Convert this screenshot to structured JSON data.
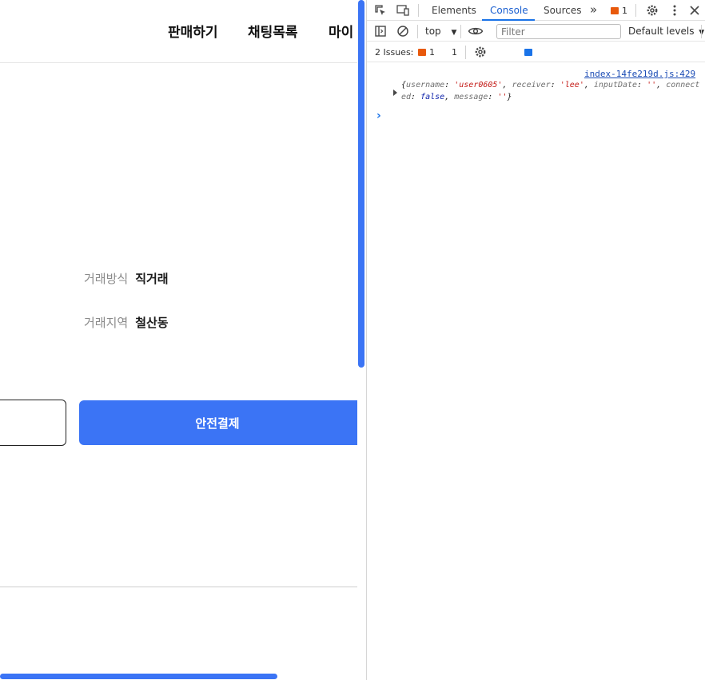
{
  "nav": {
    "sell": "판매하기",
    "chat": "채팅목록",
    "my": "마이"
  },
  "trade": {
    "method_label": "거래방식",
    "method_value": "직거래",
    "region_label": "거래지역",
    "region_value": "철산동"
  },
  "buttons": {
    "pay": "안전결제"
  },
  "devtools": {
    "tabs": {
      "elements": "Elements",
      "console": "Console",
      "sources": "Sources",
      "more": "»",
      "warn_count": "1"
    },
    "toolbar": {
      "context": "top",
      "filter_placeholder": "Filter",
      "levels": "Default levels"
    },
    "issues": {
      "label": "2 Issues:",
      "warn": "1",
      "info": "1"
    },
    "console": {
      "source": "index-14fe219d.js:429",
      "log": {
        "open": "{",
        "username_key": "username",
        "username_val": "'user0605'",
        "receiver_key": "receiver",
        "receiver_val": "'lee'",
        "inputdate_key": "inputDate",
        "inputdate_val": "''",
        "connected_key": "connected",
        "connected_val": "false",
        "message_key": "message",
        "message_val": "''",
        "close": "}"
      },
      "prompt": "›"
    }
  },
  "colors": {
    "accent": "#3b74f5",
    "devtools_blue": "#1a73e8",
    "warn": "#e8590c"
  }
}
